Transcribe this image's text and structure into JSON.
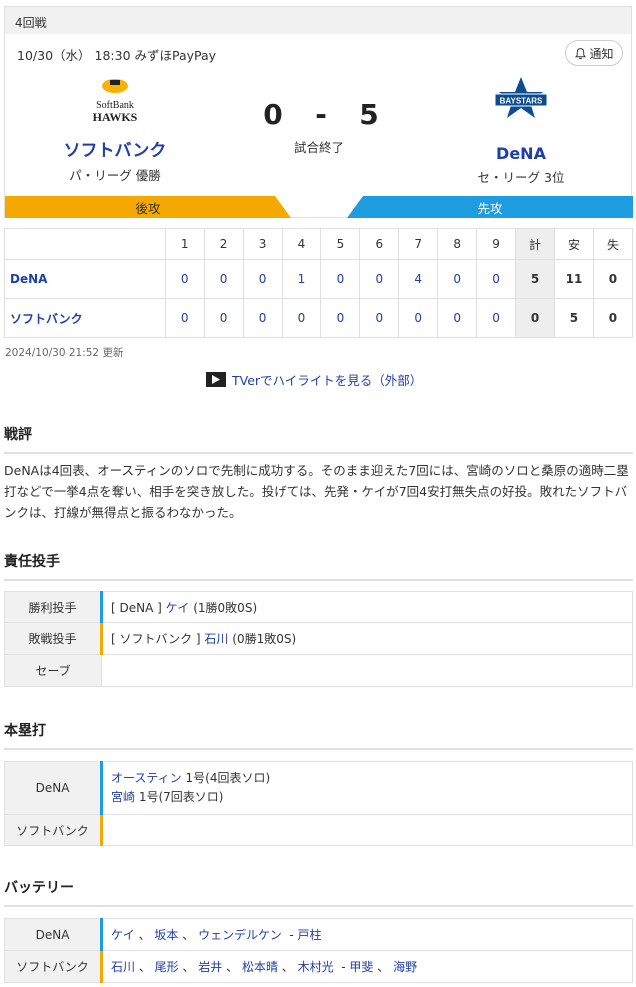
{
  "game": {
    "round": "4回戦",
    "datetime": "10/30（水） 18:30 みずほPayPay",
    "notify_label": "通知",
    "status": "試合終了",
    "home": {
      "name": "ソフトバンク",
      "league": "パ・リーグ 優勝",
      "score": "0",
      "bat": "後攻",
      "logo_text_1": "SoftBank",
      "logo_text_2": "HAWKS"
    },
    "away": {
      "name": "DeNA",
      "league": "セ・リーグ 3位",
      "score": "5",
      "bat": "先攻",
      "logo_text": "BAYSTARS"
    },
    "dash": "-"
  },
  "linescore": {
    "headers": [
      "1",
      "2",
      "3",
      "4",
      "5",
      "6",
      "7",
      "8",
      "9",
      "計",
      "安",
      "失"
    ],
    "rows": [
      {
        "team": "DeNA",
        "innings": [
          "0",
          "0",
          "0",
          "1",
          "0",
          "0",
          "4",
          "0",
          "0"
        ],
        "total": "5",
        "hits": "11",
        "errors": "0"
      },
      {
        "team": "ソフトバンク",
        "innings": [
          "0",
          "0",
          "0",
          "0",
          "0",
          "0",
          "0",
          "0",
          "0"
        ],
        "total": "0",
        "hits": "5",
        "errors": "0"
      }
    ]
  },
  "updated": "2024/10/30 21:52 更新",
  "tver_link": "TVerでハイライトを見る（外部）",
  "commentary": {
    "title": "戦評",
    "text": "DeNAは4回表、オースティンのソロで先制に成功する。そのまま迎えた7回には、宮崎のソロと桑原の適時二塁打などで一挙4点を奪い、相手を突き放した。投げては、先発・ケイが7回4安打無失点の好投。敗れたソフトバンクは、打線が無得点と振るわなかった。"
  },
  "pitchers": {
    "title": "責任投手",
    "win": {
      "label": "勝利投手",
      "team": "[ DeNA ]",
      "name": "ケイ",
      "record": "(1勝0敗0S)"
    },
    "loss": {
      "label": "敗戦投手",
      "team": "[ ソフトバンク ]",
      "name": "石川",
      "record": "(0勝1敗0S)"
    },
    "save": {
      "label": "セーブ"
    }
  },
  "homeruns": {
    "title": "本塁打",
    "dena_label": "DeNA",
    "dena": [
      {
        "name": "オースティン",
        "detail": "1号(4回表ソロ)"
      },
      {
        "name": "宮崎",
        "detail": "1号(7回表ソロ)"
      }
    ],
    "sb_label": "ソフトバンク"
  },
  "battery": {
    "title": "バッテリー",
    "dena_label": "DeNA",
    "dena_pitchers": [
      "ケイ",
      "坂本",
      "ウェンデルケン"
    ],
    "dena_catcher": "戸柱",
    "sb_label": "ソフトバンク",
    "sb_pitchers": [
      "石川",
      "尾形",
      "岩井",
      "松本晴",
      "木村光"
    ],
    "sb_catchers": [
      "甲斐",
      "海野"
    ]
  },
  "colors": {
    "home_bar": "#f5a800",
    "away_bar": "#1e9ce0",
    "link": "#1f3fa8"
  }
}
